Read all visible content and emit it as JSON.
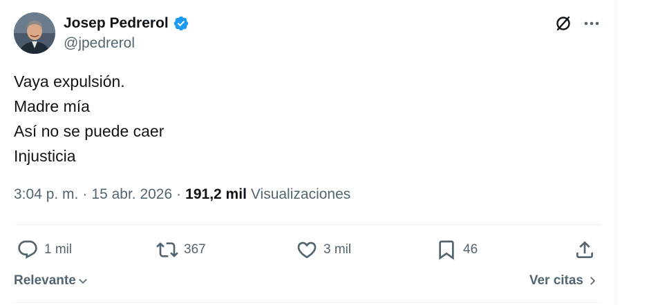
{
  "author": {
    "display_name": "Josep Pedrerol",
    "handle": "@jpedrerol",
    "verified_icon": "verified-badge-icon",
    "verified_color": "#1d9bf0"
  },
  "header_icons": [
    "grok-icon",
    "more-icon"
  ],
  "tweet": {
    "lines": [
      "Vaya expulsión.",
      "Madre mía",
      "Así no se puede caer",
      "Injusticia"
    ]
  },
  "meta": {
    "time": "3:04 p. m.",
    "separator": "·",
    "date": "15 abr. 2026",
    "views_count": "191,2 mil",
    "views_label": "Visualizaciones"
  },
  "actions": {
    "replies": "1 mil",
    "reposts": "367",
    "likes": "3 mil",
    "bookmarks": "46",
    "icons": [
      "reply-icon",
      "repost-icon",
      "like-icon",
      "bookmark-icon",
      "share-icon"
    ]
  },
  "footer": {
    "sort_label": "Relevante",
    "quotes_label": "Ver citas"
  },
  "colors": {
    "text_primary": "#0f1419",
    "text_secondary": "#536471",
    "divider": "#eff3f4"
  }
}
